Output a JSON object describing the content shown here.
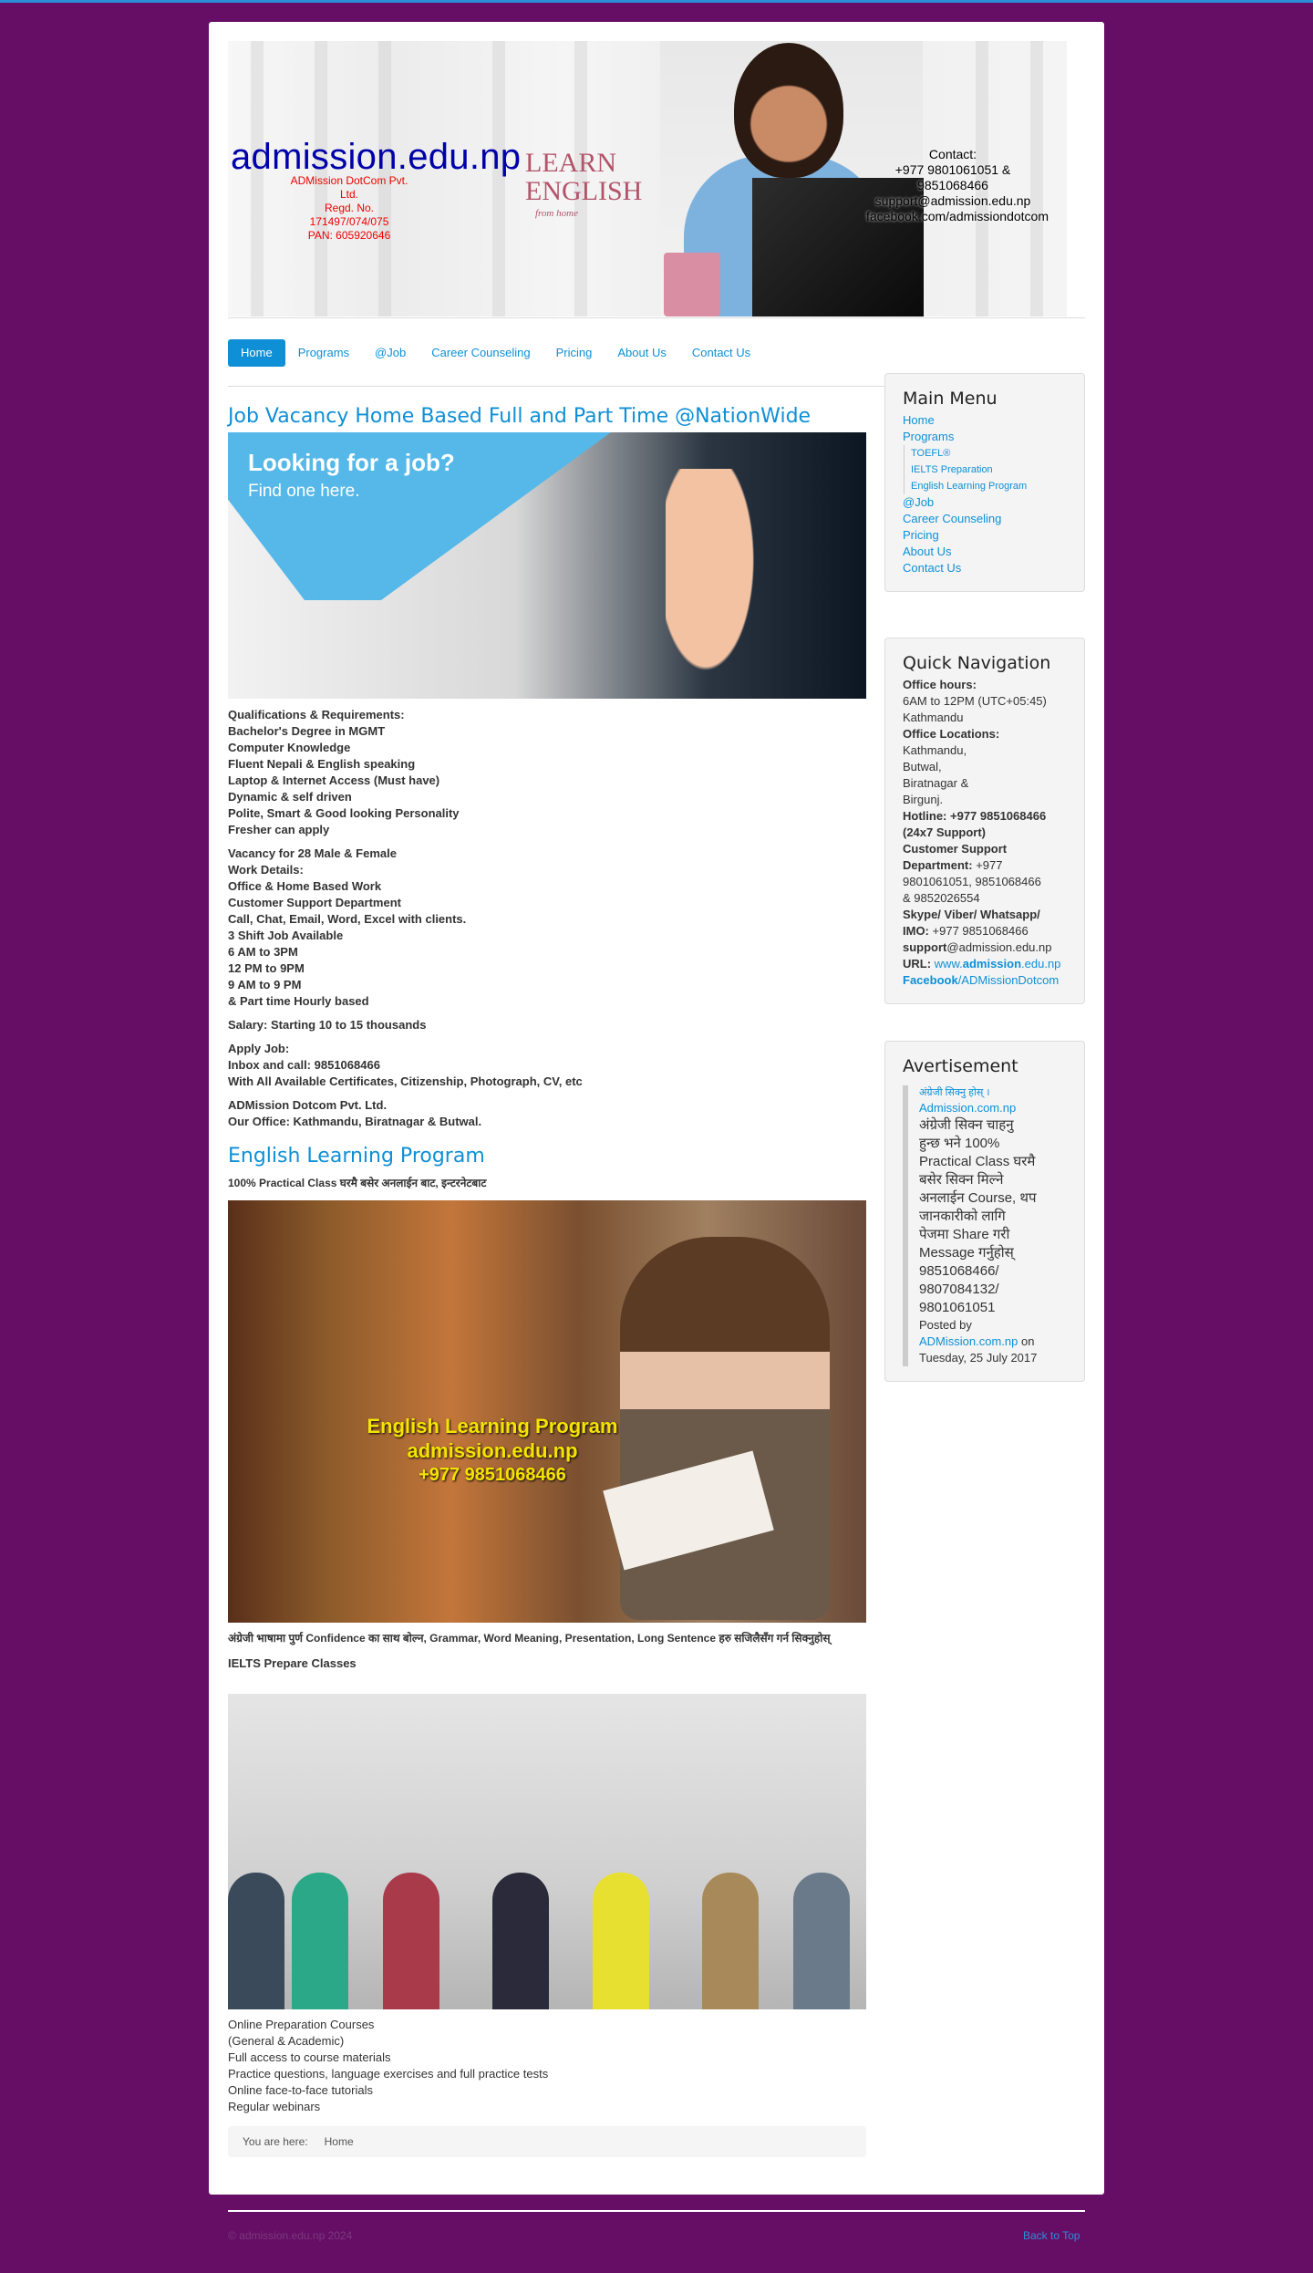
{
  "header": {
    "brand": "admission.edu.np",
    "company": [
      "ADMission DotCom Pvt. Ltd.",
      "Regd. No. 171497/074/075",
      "PAN: 605920646"
    ],
    "learn": [
      "LEARN",
      "ENGLISH"
    ],
    "from_home": "from home",
    "contact": [
      "Contact:",
      "+977 9801061051 & 9851068466",
      "support@admission.edu.np",
      "facebook.com/admissiondotcom"
    ]
  },
  "nav": [
    "Home",
    "Programs",
    "@Job",
    "Career Counseling",
    "Pricing",
    "About Us",
    "Contact Us"
  ],
  "article1": {
    "title": "Job Vacancy Home Based Full and Part Time @NationWide",
    "hero_title": "Looking for a job?",
    "hero_subtitle": "Find one here.",
    "block1": [
      "Qualifications & Requirements:",
      "Bachelor's Degree in MGMT",
      "Computer Knowledge",
      "Fluent Nepali & English speaking",
      "Laptop & Internet Access (Must have)",
      "Dynamic & self driven",
      "Polite, Smart & Good looking Personality",
      "Fresher can apply"
    ],
    "block2": [
      "Vacancy for 28 Male & Female",
      "Work Details:",
      "Office & Home Based Work",
      "Customer Support Department",
      "Call, Chat, Email, Word, Excel with clients.",
      "3 Shift Job Available",
      "6 AM to 3PM",
      "12 PM to 9PM",
      "9 AM to 9 PM",
      "& Part time Hourly based"
    ],
    "block3": [
      "Salary: Starting 10 to 15 thousands"
    ],
    "block4": [
      "Apply Job:",
      "Inbox and call: 9851068466",
      "With All Available Certificates, Citizenship, Photograph, CV, etc"
    ],
    "block5": [
      "ADMission Dotcom Pvt. Ltd.",
      "Our Office: Kathmandu, Biratnagar & Butwal."
    ]
  },
  "article2": {
    "title": "English Learning Program",
    "intro": "100% Practical Class घरमै बसेर अनलाईन बाट, इन्टरनेटबाट",
    "img_caption": [
      "English Learning Program",
      "admission.edu.np",
      "+977 9851068466"
    ],
    "para": "अंग्रेजी भाषामा पुर्ण Confidence का साथ बोल्न, Grammar, Word Meaning, Presentation, Long Sentence हरु सजिलैसँग गर्न सिक्नुहोस्",
    "ielts": "IELTS Prepare Classes",
    "list": [
      " Online Preparation Courses",
      "(General & Academic)",
      "Full access to course materials",
      "Practice questions, language exercises and full practice tests",
      "Online face-to-face tutorials",
      "Regular webinars"
    ]
  },
  "breadcrumb": {
    "label": "You are here:",
    "current": "Home"
  },
  "main_menu": {
    "title": "Main Menu",
    "items": [
      "Home",
      "Programs"
    ],
    "sub_items": [
      "TOEFL®",
      "IELTS Preparation",
      "English Learning Program"
    ],
    "items2": [
      "@Job",
      "Career Counseling",
      "Pricing",
      "About Us",
      "Contact Us"
    ]
  },
  "quick_nav": {
    "title": "Quick Navigation",
    "hours_label": "Office hours:",
    "hours": [
      "6AM to 12PM (UTC+05:45)",
      "Kathmandu"
    ],
    "loc_label": "Office Locations:",
    "locations": [
      "Kathmandu,",
      "Butwal,",
      "Biratnagar &",
      "Birgunj."
    ],
    "hotline": [
      "Hotline: +977 9851068466",
      "(24x7 Support)"
    ],
    "cs_label": [
      "Customer Support",
      "Department:"
    ],
    "cs_value": [
      "+977",
      "9801061051, 9851068466",
      "& 9852026554"
    ],
    "skype_label": [
      "Skype/ Viber/ Whatsapp/",
      "IMO:"
    ],
    "skype_value": "+977 9851068466",
    "email_bold": "support",
    "email_rest": "@admission.edu.np",
    "url_label": "URL:",
    "url_a": "www.",
    "url_b": "admission",
    "url_c": ".edu.np",
    "fb_bold": "Facebook",
    "fb_rest": "/ADMissionDotcom"
  },
  "advert": {
    "title": "Avertisement",
    "link": "अंग्रेजी सिक्नु होस् ।",
    "link2": "Admission.com.np",
    "body": [
      "अंग्रेजी सिक्न चाहनु",
      "हुन्छ भने 100%",
      "Practical Class घरमै",
      "बसेर सिक्न मिल्ने",
      "अनलाईन Course, थप",
      "जानकारीको लागि",
      "पेजमा Share गरी",
      "Message गर्नुहोस्",
      "9851068466/",
      "9807084132/",
      "9801061051"
    ],
    "posted_by": "Posted by",
    "poster": "ADMission.com.np",
    "on": " on",
    "date": "Tuesday, 25 July 2017"
  },
  "footer": {
    "copyright": "© admission.edu.np 2024",
    "back_to_top": "Back to Top"
  }
}
